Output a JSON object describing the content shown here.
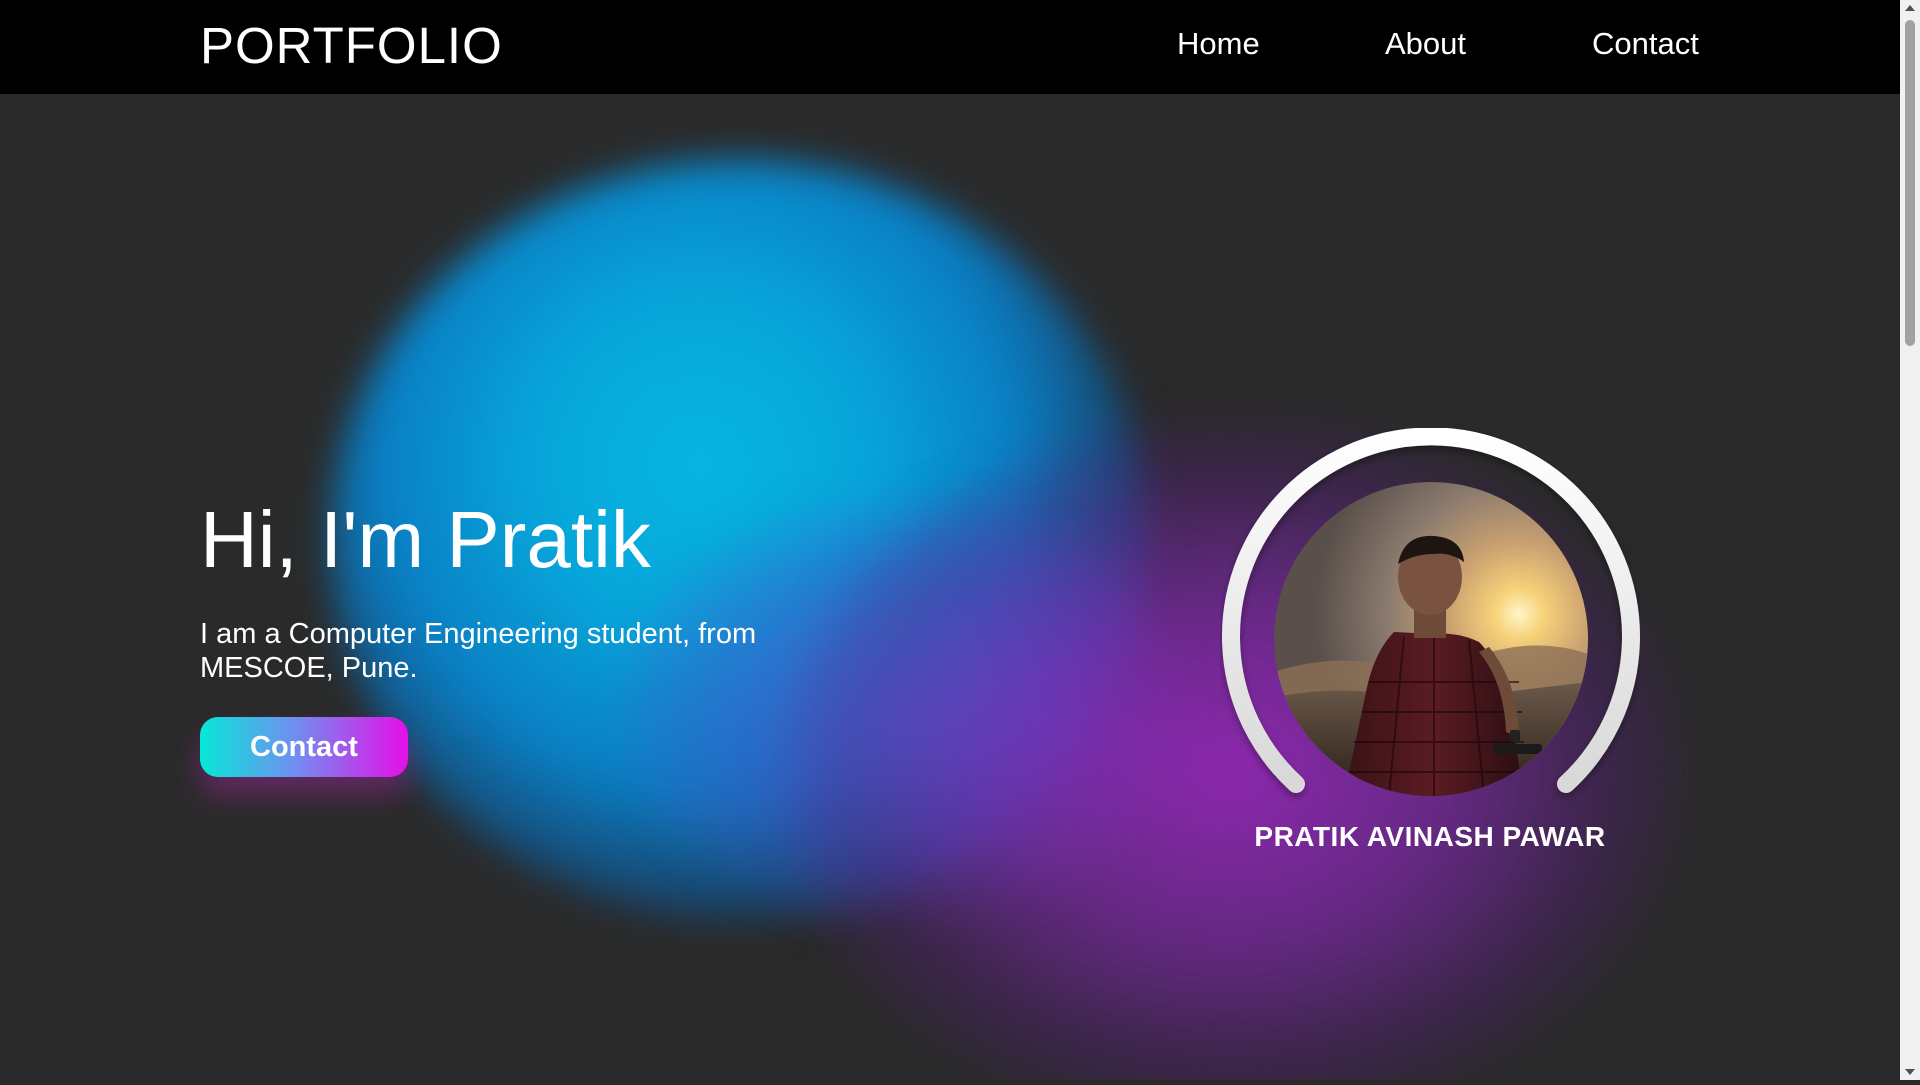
{
  "navbar": {
    "brand": "PORTFOLIO",
    "links": [
      {
        "label": "Home"
      },
      {
        "label": "About"
      },
      {
        "label": "Contact"
      }
    ]
  },
  "hero": {
    "title": "Hi, I'm Pratik",
    "subtitle": "I am a Computer Engineering student, from MESCOE, Pune.",
    "button_label": "Contact"
  },
  "profile": {
    "name": "PRATIK AVINASH PAWAR"
  },
  "colors": {
    "page_background": "#2a2a2a",
    "navbar_background": "#000000",
    "glow_cyan": "#06b6e0",
    "glow_purple": "#a028c8",
    "button_gradient_start": "#06e8d8",
    "button_gradient_end": "#e60fe8",
    "text": "#ffffff"
  },
  "icons": {
    "scroll_up": "triangle-up-icon",
    "scroll_down": "triangle-down-icon"
  }
}
